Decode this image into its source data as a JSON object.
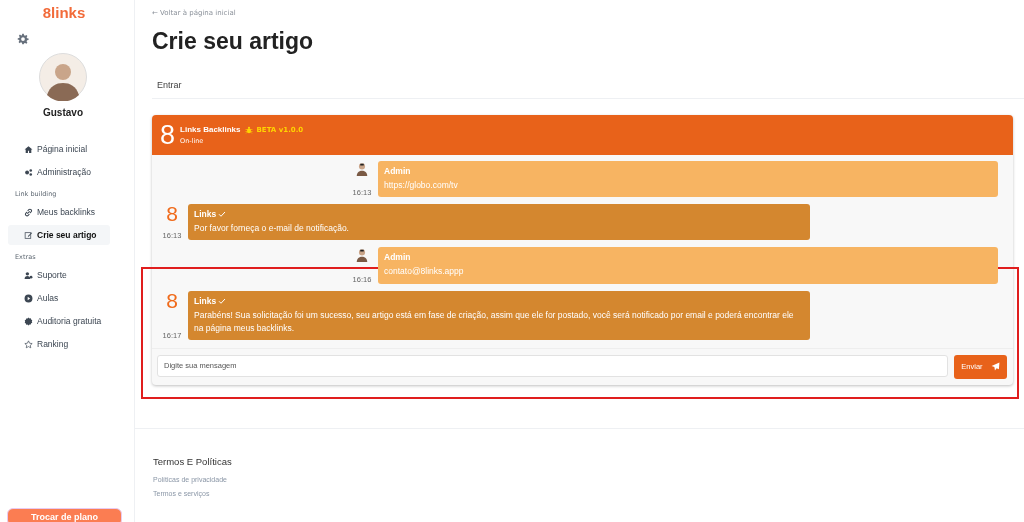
{
  "sidebar": {
    "logo": "8links",
    "user": {
      "name": "Gustavo"
    },
    "sections": [
      {
        "items": [
          {
            "label": "Página inicial",
            "selected": false
          },
          {
            "label": "Administração",
            "selected": false
          }
        ]
      },
      {
        "heading": "Link building",
        "items": [
          {
            "label": "Meus backlinks",
            "selected": false
          },
          {
            "label": "Crie seu artigo",
            "selected": true
          }
        ]
      },
      {
        "heading": "Extras",
        "items": [
          {
            "label": "Suporte",
            "selected": false
          },
          {
            "label": "Aulas",
            "selected": false
          },
          {
            "label": "Auditoria gratuita",
            "selected": false
          },
          {
            "label": "Ranking",
            "selected": false
          }
        ]
      }
    ],
    "plan_button": "Trocar de plano"
  },
  "page": {
    "back_link": "← Voltar à página inicial",
    "title": "Crie seu artigo",
    "tabs": [
      {
        "label": "Entrar",
        "selected": false
      }
    ]
  },
  "chat": {
    "logo": "8",
    "name": "Links Backlinks",
    "beta": "BETA v1.0.0",
    "status": "On-line",
    "messages": [
      {
        "kind": "admin",
        "sender": "Admin",
        "time": "16:13",
        "text": "https://globo.com/tv"
      },
      {
        "kind": "bot",
        "avatar": "8",
        "sender": "Links",
        "verified": true,
        "time": "16:13",
        "text": "Por favor forneça o e-mail de notificação."
      },
      {
        "kind": "admin",
        "sender": "Admin",
        "time": "16:16",
        "text": "contato@8links.appp"
      },
      {
        "kind": "bot",
        "avatar": "8",
        "sender": "Links",
        "verified": true,
        "time": "16:17",
        "text": "Parabéns! Sua solicitação foi um sucesso, seu artigo está em fase de criação, assim que ele for postado, você será notificado por email e poderá encontrar ele na página meus backlinks."
      }
    ],
    "input": {
      "placeholder": "Digite sua mensagem"
    },
    "send_button": "Enviar"
  },
  "footer": {
    "heading": "Termos E Políticas",
    "links": [
      "Políticas de privacidade",
      "Termos e serviços"
    ]
  }
}
